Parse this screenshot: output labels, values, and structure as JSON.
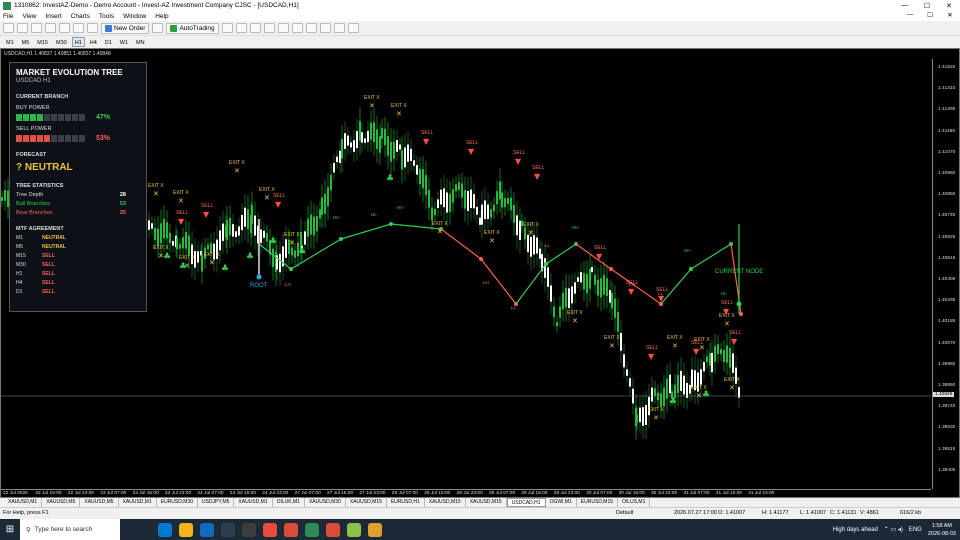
{
  "window": {
    "title": "1310862: InvestAZ-Demo - Demo Account - Invest-AZ Investment Company CJSC - [USDCAD,H1]",
    "minimize": "—",
    "maximize": "☐",
    "close": "✕"
  },
  "menu": {
    "items": [
      "File",
      "View",
      "Insert",
      "Charts",
      "Tools",
      "Window",
      "Help"
    ],
    "right": [
      "—",
      "☐",
      "✕"
    ]
  },
  "toolbar": {
    "new_order": "New Order",
    "auto_trading": "AutoTrading"
  },
  "timeframes": [
    "M1",
    "M5",
    "M15",
    "M30",
    "H1",
    "H4",
    "D1",
    "W1",
    "MN"
  ],
  "selected_timeframe": "H1",
  "chart": {
    "header": "USDCAD,H1  1.40837 1.40851 1.40837 1.40848",
    "price_labels": [
      "1.41520",
      "1.41410",
      "1.41295",
      "1.41185",
      "1.41070",
      "1.40960",
      "1.40850",
      "1.40740",
      "1.40625",
      "1.40515",
      "1.40405",
      "1.40295",
      "1.40185",
      "1.40070",
      "1.39960",
      "1.39850",
      "1.39740",
      "1.39630",
      "1.39515",
      "1.39405"
    ],
    "current_price": "1.40848",
    "time_labels": [
      "22 Jul 2026",
      "22 Jul 15:00",
      "22 Jul 23:00",
      "23 Jul 07:00",
      "23 Jul 15:00",
      "23 Jul 23:00",
      "24 Jul 07:00",
      "24 Jul 15:00",
      "24 Jul 23:00",
      "27 Jul 07:00",
      "27 Jul 15:00",
      "27 Jul 23:00",
      "28 Jul 07:00",
      "28 Jul 15:00",
      "28 Jul 23:00",
      "29 Jul 07:00",
      "29 Jul 15:00",
      "29 Jul 23:00",
      "30 Jul 07:00",
      "30 Jul 15:00",
      "30 Jul 23:00",
      "31 Jul 07:00",
      "31 Jul 15:00",
      "31 Jul 23:00"
    ],
    "labels": {
      "root": "ROOT",
      "current_node": "CURRENT NODE",
      "exit": "EXIT X",
      "sell": "SELL",
      "hh": "HH",
      "hl": "HL",
      "lh": "LH",
      "ll": "LL"
    },
    "colors": {
      "bull": "#1fbf3a",
      "bear": "#e0503c",
      "exit": "#f0c040",
      "node_up": "#30d050",
      "node_down": "#ff6050",
      "root": "#29a8e0",
      "background": "#000000"
    }
  },
  "panel": {
    "title": "MARKET EVOLUTION TREE",
    "symbol": "USDCAD  H1",
    "current_branch": "CURRENT BRANCH",
    "buy_label": "BUY POWER",
    "buy_pct": "47%",
    "buy_filled": 4,
    "sell_label": "SELL POWER",
    "sell_pct": "53%",
    "sell_filled": 5,
    "segments": 10,
    "forecast_label": "FORECAST",
    "forecast": "? NEUTRAL",
    "stats_title": "TREE STATISTICS",
    "stats": [
      {
        "k": "Tree Depth",
        "v": "28",
        "c": "#ffffff"
      },
      {
        "k": "Bull Branches",
        "v": "53",
        "c": "#30d050"
      },
      {
        "k": "Bear Branches",
        "v": "25",
        "c": "#ff6050"
      }
    ],
    "mtf_title": "MTF AGREEMENT",
    "mtf": [
      {
        "tf": "M1",
        "s": "NEUTRAL",
        "c": "#f0c040"
      },
      {
        "tf": "M5",
        "s": "NEUTRAL",
        "c": "#f0c040"
      },
      {
        "tf": "M15",
        "s": "SELL",
        "c": "#ff6050"
      },
      {
        "tf": "M30",
        "s": "SELL",
        "c": "#ff6050"
      },
      {
        "tf": "H1",
        "s": "SELL",
        "c": "#ff6050"
      },
      {
        "tf": "H4",
        "s": "SELL",
        "c": "#ff6050"
      },
      {
        "tf": "D1",
        "s": "SELL",
        "c": "#ff6050"
      }
    ]
  },
  "tabs": [
    "XAUUSD,M1",
    "XAUUSD,M5",
    "XAUUSD,M5",
    "XAUUSD,M1",
    "EURUSD,M30",
    "USDJPY,M5",
    "XAUUSD,M1",
    "OILUK,M1",
    "XAUUSD,M30",
    "XAUUSD,M15",
    "EURUSD,H1",
    "XAUUSD,M15",
    "XAUUSD,M15",
    "USDCAD,H1",
    "OGWI,M1",
    "EURUSD,M15",
    "OILUS,M1"
  ],
  "active_tab": "USDCAD,H1",
  "status": {
    "help": "For Help, press F1",
    "profile": "Default",
    "dt": "2026.07.27 17:00",
    "open": "O: 1.41007",
    "high": "H: 1.41177",
    "low": "L: 1.41007",
    "close": "C: 1.41131",
    "vol": "V: 4861",
    "conn": "616/2 kb"
  },
  "taskbar": {
    "search": "Type here to search",
    "weather": "High days ahead",
    "lang": "ENG",
    "time": "1:58 AM",
    "date": "2026-08-03"
  }
}
